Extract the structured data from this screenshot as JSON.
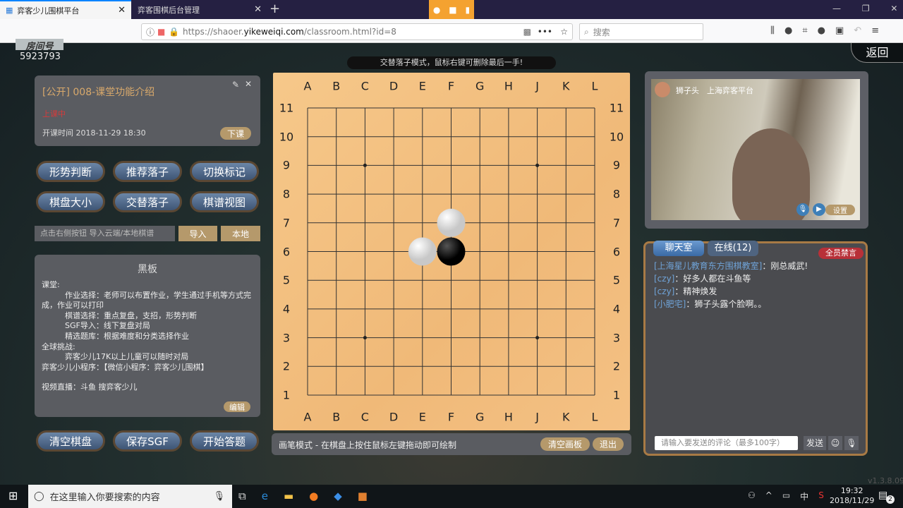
{
  "browser": {
    "tabs": [
      {
        "label": "弈客少儿围棋平台"
      },
      {
        "label": "弈客围棋后台管理"
      }
    ],
    "url_prefix": "https://shaoer.",
    "url_domain": "yikeweiqi.com",
    "url_path": "/classroom.html?id=8",
    "search_placeholder": "搜索"
  },
  "header": {
    "room_label": "房间号",
    "room_number": "5923793",
    "mode_hint": "交替落子模式，鼠标右键可删除最后一手!",
    "back_label": "返回"
  },
  "class_info": {
    "title": "[公开] 008-课堂功能介绍",
    "status": "上课中",
    "start_time": "开课时间 2018-11-29 18:30",
    "end_button": "下课"
  },
  "tools": [
    "形势判断",
    "推荐落子",
    "切换标记",
    "棋盘大小",
    "交替落子",
    "棋谱视图"
  ],
  "import": {
    "placeholder": "点击右侧按钮 导入云端/本地棋谱",
    "import_button": "导入",
    "local_button": "本地"
  },
  "blackboard": {
    "title": "黑板",
    "lines": [
      "课堂:",
      "　　　作业选择：老师可以布置作业，学生通过手机等方式完成，作业可以打印",
      "　　　棋谱选择：重点复盘，支招，形势判断",
      "　　　SGF导入：线下复盘对局",
      "　　　精选题库：根据难度和分类选择作业",
      "全球挑战:",
      "　　　弈客少儿17K以上儿童可以随时对局",
      "弈客少儿小程序：【微信小程序：弈客少儿围棋】",
      "",
      "视频直播：斗鱼 搜弈客少儿"
    ],
    "edit_button": "编辑"
  },
  "bottom_buttons": [
    "清空棋盘",
    "保存SGF",
    "开始答题"
  ],
  "board": {
    "size": 11,
    "columns": [
      "A",
      "B",
      "C",
      "D",
      "E",
      "F",
      "G",
      "H",
      "J",
      "K",
      "L"
    ],
    "rows": [
      "11",
      "10",
      "9",
      "8",
      "7",
      "6",
      "5",
      "4",
      "3",
      "2",
      "1"
    ],
    "stars": [
      [
        2,
        2
      ],
      [
        8,
        2
      ],
      [
        2,
        8
      ],
      [
        8,
        8
      ]
    ],
    "stones": [
      {
        "color": "white",
        "col": "F",
        "row": 7
      },
      {
        "color": "white",
        "col": "E",
        "row": 6
      },
      {
        "color": "black",
        "col": "F",
        "row": 6
      }
    ]
  },
  "draw_bar": {
    "hint": "画笔模式 - 在棋盘上按住鼠标左键拖动即可绘制",
    "clear_button": "清空画板",
    "exit_button": "退出"
  },
  "video": {
    "name": "狮子头",
    "org": "上海弈客平台",
    "settings": "设置"
  },
  "chat": {
    "tab_chat": "聊天室",
    "tab_online": "在线(12)",
    "mute_all": "全员禁言",
    "messages": [
      {
        "user": "[上海星儿教育东方围棋教室]",
        "text": "：刚总威武!"
      },
      {
        "user": "[czy]",
        "text": "：好多人都在斗鱼等"
      },
      {
        "user": "[czy]",
        "text": "：精神焕发"
      },
      {
        "user": "[小肥宅]",
        "text": "：狮子头露个脸啊。。"
      }
    ],
    "input_placeholder": "请输入要发送的评论（最多100字）",
    "send": "发送"
  },
  "version": "v1.3.8.09",
  "taskbar": {
    "search_placeholder": "在这里输入你要搜索的内容",
    "ime": "中",
    "time": "19:32",
    "date": "2018/11/29",
    "notifications": "2"
  }
}
